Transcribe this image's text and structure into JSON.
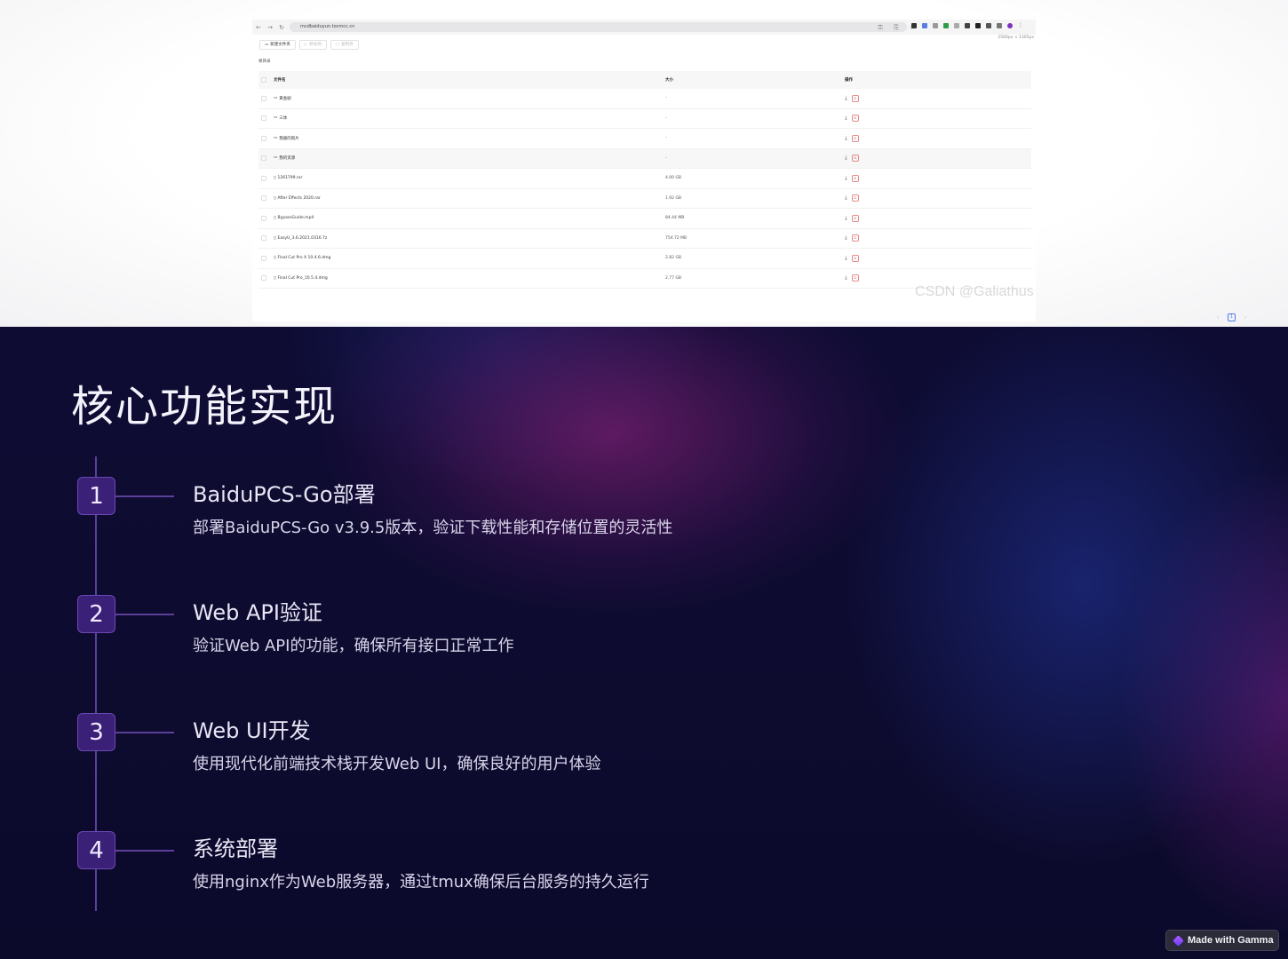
{
  "browser": {
    "url": "mcdbaiduyun.tocmcc.cn",
    "dimensions": "2560px × 1305px",
    "toolbar": {
      "new_folder": "新建文件夹",
      "move": "移动到",
      "copy": "复制到"
    },
    "breadcrumb": "根目录",
    "table": {
      "headers": {
        "name": "文件名",
        "size": "大小",
        "ops": "操作"
      },
      "rows": [
        {
          "name": "黄金剧",
          "size": "-",
          "type": "folder"
        },
        {
          "name": "三体",
          "size": "-",
          "type": "folder"
        },
        {
          "name": "我服的照片",
          "size": "-",
          "type": "folder"
        },
        {
          "name": "我的资源",
          "size": "-",
          "type": "folder"
        },
        {
          "name": "1261799.rar",
          "size": "4.00 GB",
          "type": "file"
        },
        {
          "name": "After Effects 2020.rar",
          "size": "1.92 GB",
          "type": "file"
        },
        {
          "name": "BypassGuide.mp4",
          "size": "84.44 MB",
          "type": "file"
        },
        {
          "name": "EasyU_3.6.2021.0316.7z",
          "size": "754.72 MB",
          "type": "file"
        },
        {
          "name": "Final Cut Pro X 10.4.6.dmg",
          "size": "2.82 GB",
          "type": "file"
        },
        {
          "name": "Final Cut Pro_10.5.4.dmg",
          "size": "2.77 GB",
          "type": "file"
        }
      ]
    },
    "pager": {
      "prev": "‹",
      "current": "1",
      "next": "›"
    },
    "watermark": "CSDN @Galiathus"
  },
  "slide": {
    "title": "核心功能实现",
    "steps": [
      {
        "num": "1",
        "title": "BaiduPCS-Go部署",
        "desc": "部署BaiduPCS-Go v3.9.5版本，验证下载性能和存储位置的灵活性"
      },
      {
        "num": "2",
        "title": "Web API验证",
        "desc": "验证Web API的功能，确保所有接口正常工作"
      },
      {
        "num": "3",
        "title": "Web UI开发",
        "desc": "使用现代化前端技术栈开发Web UI，确保良好的用户体验"
      },
      {
        "num": "4",
        "title": "系统部署",
        "desc": "使用nginx作为Web服务器，通过tmux确保后台服务的持久运行"
      }
    ]
  },
  "badge": {
    "label": "Made with Gamma"
  },
  "colors": {
    "accent": "#3b2077",
    "timeline": "#5b3f9a",
    "background": "#0d0b2c"
  }
}
